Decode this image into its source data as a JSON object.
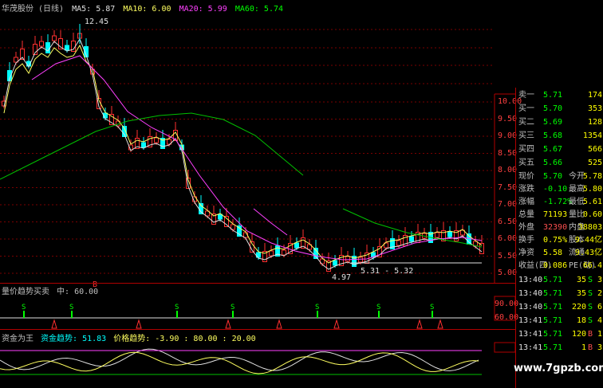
{
  "header": {
    "stock_name": "华茂股份 (日线)",
    "ma5": "MA5: 5.87",
    "ma10": "MA10: 6.00",
    "ma20": "MA20: 5.99",
    "ma60": "MA60: 5.74"
  },
  "annotations": {
    "high": "12.45",
    "low": "4.97",
    "range": "5.31 - 5.32",
    "b_marker": "B",
    "s_marker": "S"
  },
  "price_axis": [
    "10.00",
    "9.50",
    "9.00",
    "8.50",
    "8.00",
    "7.50",
    "7.00",
    "6.50",
    "6.00",
    "5.50",
    "5.00"
  ],
  "indicator1": {
    "title": "量价趋势买卖",
    "value": "中: 60.00",
    "axis": [
      "90.00",
      "60.00"
    ]
  },
  "indicator2": {
    "title": "资金为王",
    "fund_trend": "资金趋势: 51.83",
    "price_trend": "价格趋势: -3.90 : 80.00 : 20.00"
  },
  "order_book": [
    {
      "label": "卖一",
      "price": "5.71",
      "vol": "174"
    },
    {
      "label": "买一",
      "price": "5.70",
      "vol": "353"
    },
    {
      "label": "买二",
      "price": "5.69",
      "vol": "128"
    },
    {
      "label": "买三",
      "price": "5.68",
      "vol": "1354"
    },
    {
      "label": "买四",
      "price": "5.67",
      "vol": "566"
    },
    {
      "label": "买五",
      "price": "5.66",
      "vol": "525"
    }
  ],
  "quote": [
    {
      "l1": "现价",
      "v1": "5.70",
      "l2": "今开",
      "v2": "5.78"
    },
    {
      "l1": "涨跌",
      "v1": "-0.10",
      "l2": "最高",
      "v2": "5.80"
    },
    {
      "l1": "涨幅",
      "v1": "-1.72%",
      "l2": "最低",
      "v2": "5.61"
    },
    {
      "l1": "总量",
      "v1": "71193",
      "l2": "量比",
      "v2": "0.60"
    },
    {
      "l1": "外盘",
      "v1": "32390",
      "l2": "内盘",
      "v2": "38803"
    },
    {
      "l1": "换手",
      "v1": "0.75%",
      "l2": "股本",
      "v2": "9.44亿"
    },
    {
      "l1": "净资",
      "v1": "5.58",
      "l2": "流通",
      "v2": "9.43亿"
    },
    {
      "l1": "收益(四)",
      "v1": "0.086",
      "l2": "PE(动)",
      "v2": "66.4"
    }
  ],
  "ticks": [
    {
      "time": "13:40",
      "price": "5.71",
      "vol": "35",
      "side": "S"
    },
    {
      "time": "13:40",
      "price": "5.71",
      "vol": "35",
      "side": "S"
    },
    {
      "time": "13:40",
      "price": "5.71",
      "vol": "220",
      "side": "S"
    },
    {
      "time": "13:41",
      "price": "5.71",
      "vol": "18",
      "side": "S"
    },
    {
      "time": "13:41",
      "price": "5.71",
      "vol": "120",
      "side": "B"
    },
    {
      "time": "13:41",
      "price": "5.71",
      "vol": "1",
      "side": "B"
    }
  ],
  "tick_extra": [
    "3",
    "2",
    "6",
    "4",
    "1",
    "3"
  ],
  "watermark": "www.7gpzb.com"
}
